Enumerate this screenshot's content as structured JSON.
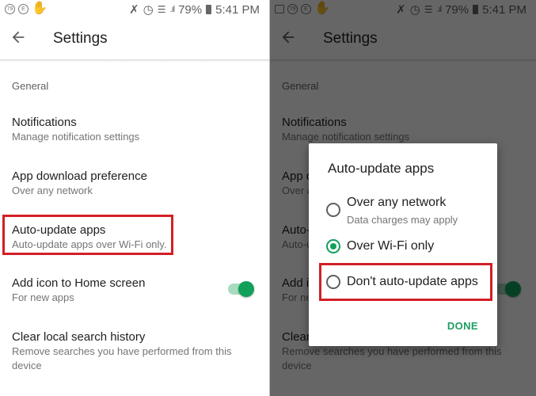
{
  "status_bar": {
    "left_icons": [
      "notification-badge-79",
      "notification-e",
      "hand-gesture"
    ],
    "left_icons_right_panel": [
      "image-notification",
      "notification-badge-79",
      "notification-e",
      "hand-gesture"
    ],
    "badge_text": "79",
    "e_text": "E",
    "icons": [
      "mute-icon",
      "alarm-icon",
      "wifi-icon",
      "signal-icon",
      "battery-icon"
    ],
    "battery": "79%",
    "time": "5:41 PM"
  },
  "toolbar": {
    "title": "Settings",
    "back_icon": "arrow-left"
  },
  "settings": {
    "section": "General",
    "items": [
      {
        "title": "Notifications",
        "subtitle": "Manage notification settings"
      },
      {
        "title": "App download preference",
        "subtitle": "Over any network"
      },
      {
        "title": "Auto-update apps",
        "subtitle": "Auto-update apps over Wi-Fi only."
      },
      {
        "title": "Add icon to Home screen",
        "subtitle": "For new apps",
        "toggle_on": true
      },
      {
        "title": "Clear local search history",
        "subtitle": "Remove searches you have performed from this device"
      }
    ]
  },
  "dialog": {
    "title": "Auto-update apps",
    "options": [
      {
        "label": "Over any network",
        "sublabel": "Data charges may apply",
        "selected": false
      },
      {
        "label": "Over Wi-Fi only",
        "sublabel": "",
        "selected": true
      },
      {
        "label": "Don't auto-update apps",
        "sublabel": "",
        "selected": false
      }
    ],
    "done_label": "DONE"
  },
  "colors": {
    "accent_green": "#11a05a",
    "highlight_red": "#d21f26"
  }
}
